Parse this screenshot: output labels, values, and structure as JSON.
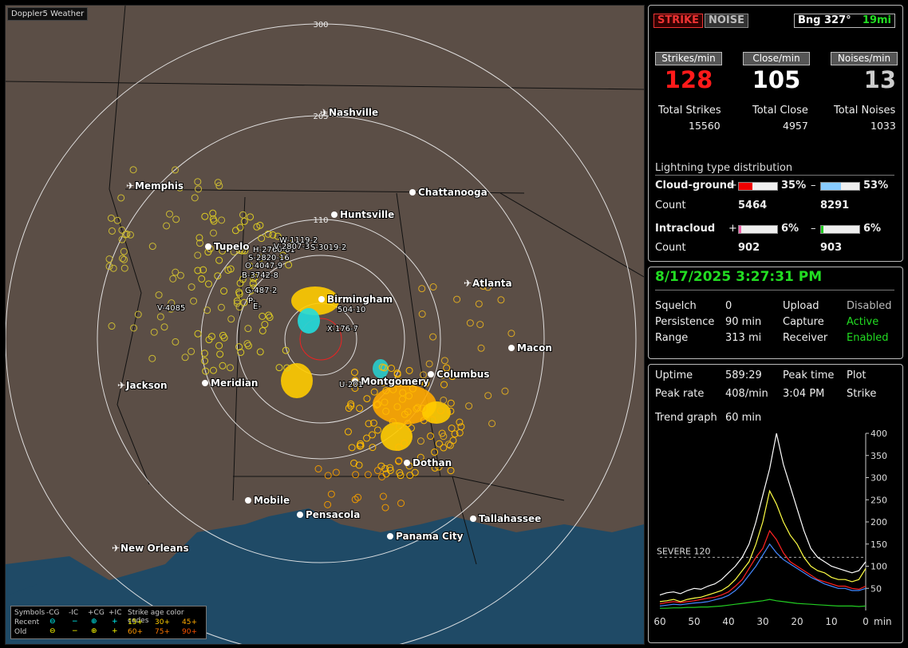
{
  "app": {
    "title": "Doppler5 Weather"
  },
  "map": {
    "range_labels": [
      "300",
      "205",
      "110"
    ],
    "cities": [
      {
        "name": "Nashville",
        "airport": true
      },
      {
        "name": "Memphis",
        "airport": true
      },
      {
        "name": "Chattanooga",
        "airport": false
      },
      {
        "name": "Huntsville",
        "airport": false
      },
      {
        "name": "Tupelo",
        "airport": false
      },
      {
        "name": "Atlanta",
        "airport": true
      },
      {
        "name": "Birmingham",
        "airport": false
      },
      {
        "name": "Macon",
        "airport": false
      },
      {
        "name": "Jackson",
        "airport": true
      },
      {
        "name": "Meridian",
        "airport": false
      },
      {
        "name": "Montgomery",
        "airport": false
      },
      {
        "name": "Columbus",
        "airport": false
      },
      {
        "name": "Dothan",
        "airport": false
      },
      {
        "name": "Mobile",
        "airport": false
      },
      {
        "name": "Pensacola",
        "airport": false
      },
      {
        "name": "Tallahassee",
        "airport": false
      },
      {
        "name": "Panama City",
        "airport": false
      },
      {
        "name": "New Orleans",
        "airport": true
      }
    ],
    "storm_tags": [
      "W-1119-2",
      "H-2760-81",
      "V-2807-3",
      "S-3019-2",
      "S-2820-16",
      "O-4047-9",
      "B-3742-8",
      "G-487-2",
      "P-",
      "E-",
      "V-4085",
      "504-10",
      "X-176-7",
      "U-201"
    ]
  },
  "legend": {
    "symbols": "Symbols",
    "cg_neg": "-CG",
    "ic_neg": "-IC",
    "cg_pos": "+CG",
    "ic_pos": "+IC",
    "age_title": "Strike age color codes",
    "recent": "Recent",
    "old": "Old",
    "recent_ages": [
      "15+",
      "30+",
      "45+"
    ],
    "old_ages": [
      "60+",
      "75+",
      "90+"
    ]
  },
  "top": {
    "strike_btn": "STRIKE",
    "noise_btn": "NOISE",
    "bearing_label": "Bng 327°",
    "bearing_dist": "19mi",
    "strikes_hdr": "Strikes/min",
    "close_hdr": "Close/min",
    "noises_hdr": "Noises/min",
    "strikes_val": "128",
    "close_val": "105",
    "noises_val": "13",
    "total_strikes_lbl": "Total Strikes",
    "total_close_lbl": "Total Close",
    "total_noises_lbl": "Total Noises",
    "total_strikes": "15560",
    "total_close": "4957",
    "total_noises": "1033"
  },
  "distribution": {
    "title": "Lightning type distribution",
    "cg_label": "Cloud-ground",
    "ic_label": "Intracloud",
    "count_label": "Count",
    "cg_pos_pct": "35%",
    "cg_neg_pct": "53%",
    "ic_pos_pct": "6%",
    "ic_neg_pct": "6%",
    "cg_pos_count": "5464",
    "cg_neg_count": "8291",
    "ic_pos_count": "902",
    "ic_neg_count": "903",
    "cg_pos_frac": 0.35,
    "cg_neg_frac": 0.53,
    "ic_pos_frac": 0.06,
    "ic_neg_frac": 0.06,
    "plus": "+",
    "minus": "–"
  },
  "status": {
    "datetime": "8/17/2025 3:27:31 PM",
    "squelch_lbl": "Squelch",
    "squelch": "0",
    "persistence_lbl": "Persistence",
    "persistence": "90 min",
    "range_lbl": "Range",
    "range": "313 mi",
    "upload_lbl": "Upload",
    "upload": "Disabled",
    "capture_lbl": "Capture",
    "capture": "Active",
    "receiver_lbl": "Receiver",
    "receiver": "Enabled"
  },
  "stats": {
    "uptime_lbl": "Uptime",
    "uptime": "589:29",
    "peak_time_lbl": "Peak time",
    "peak_time": "3:04 PM",
    "plot_lbl": "Plot",
    "plot": "Strike",
    "peak_rate_lbl": "Peak rate",
    "peak_rate": "408/min",
    "trend_lbl": "Trend graph",
    "trend": "60 min"
  },
  "chart_data": {
    "type": "line",
    "xlabel": "min",
    "x_ticks": [
      "60",
      "50",
      "40",
      "30",
      "20",
      "10",
      "0"
    ],
    "y_ticks": [
      "400",
      "350",
      "300",
      "250",
      "200",
      "150",
      "100",
      "50"
    ],
    "ylim": [
      0,
      400
    ],
    "xlim": [
      60,
      0
    ],
    "threshold": {
      "label": "SEVERE 120",
      "value": 120
    },
    "series": [
      {
        "color": "#ffffff",
        "values": [
          35,
          40,
          42,
          38,
          45,
          50,
          48,
          55,
          60,
          70,
          85,
          100,
          120,
          150,
          200,
          260,
          320,
          400,
          330,
          280,
          230,
          180,
          140,
          120,
          110,
          100,
          95,
          90,
          85,
          90,
          110
        ]
      },
      {
        "color": "#ffff44",
        "values": [
          20,
          22,
          25,
          20,
          25,
          28,
          30,
          35,
          40,
          45,
          55,
          70,
          90,
          110,
          150,
          200,
          270,
          240,
          200,
          170,
          150,
          120,
          100,
          90,
          85,
          75,
          70,
          70,
          65,
          70,
          95
        ]
      },
      {
        "color": "#ff2222",
        "values": [
          15,
          18,
          20,
          18,
          20,
          22,
          25,
          28,
          30,
          35,
          42,
          55,
          70,
          95,
          120,
          140,
          180,
          160,
          130,
          110,
          100,
          90,
          80,
          70,
          65,
          60,
          55,
          55,
          50,
          48,
          55
        ]
      },
      {
        "color": "#4488ff",
        "values": [
          10,
          12,
          14,
          13,
          15,
          17,
          18,
          20,
          24,
          28,
          34,
          45,
          60,
          80,
          100,
          125,
          150,
          130,
          115,
          105,
          95,
          85,
          75,
          68,
          60,
          55,
          50,
          50,
          45,
          45,
          50
        ]
      },
      {
        "color": "#22cc22",
        "values": [
          5,
          5,
          6,
          6,
          7,
          7,
          8,
          8,
          9,
          10,
          12,
          14,
          16,
          18,
          20,
          22,
          25,
          22,
          20,
          18,
          16,
          15,
          14,
          13,
          12,
          11,
          10,
          10,
          10,
          9,
          10
        ]
      }
    ]
  }
}
